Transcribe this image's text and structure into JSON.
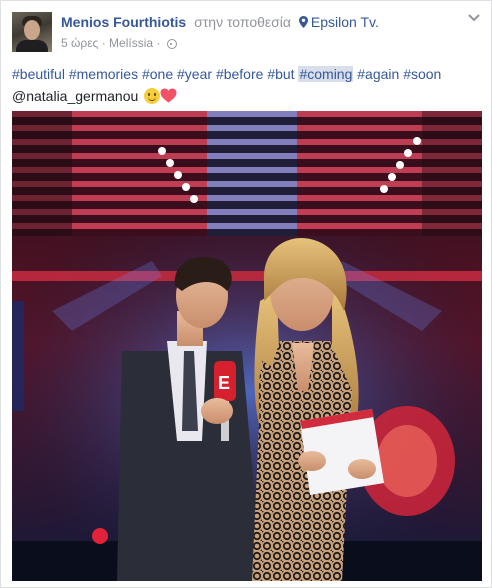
{
  "post": {
    "author": "Menios Fourthiotis",
    "location_verb": "στην τοποθεσία",
    "location": "Epsilon Tv.",
    "time": "5 ώρες",
    "separator": "·",
    "place_tag": "Melíssia",
    "separator2": "·",
    "privacy_icon": "globe-icon",
    "menu_icon": "chevron-down-icon",
    "hashtags": [
      "#beutiful",
      "#memories",
      "#one",
      "#year",
      "#before",
      "#but",
      "#coming",
      "#again",
      "#soon"
    ],
    "highlighted_hashtag": "#coming",
    "mention": "@natalia_germanou",
    "emojis": [
      "smile-emoji",
      "heart-emoji"
    ],
    "photo": "tv-studio-hosts-photo"
  },
  "colors": {
    "link": "#365899",
    "meta": "#90949c",
    "highlight": "#d8dfea",
    "heart": "#f25268"
  }
}
